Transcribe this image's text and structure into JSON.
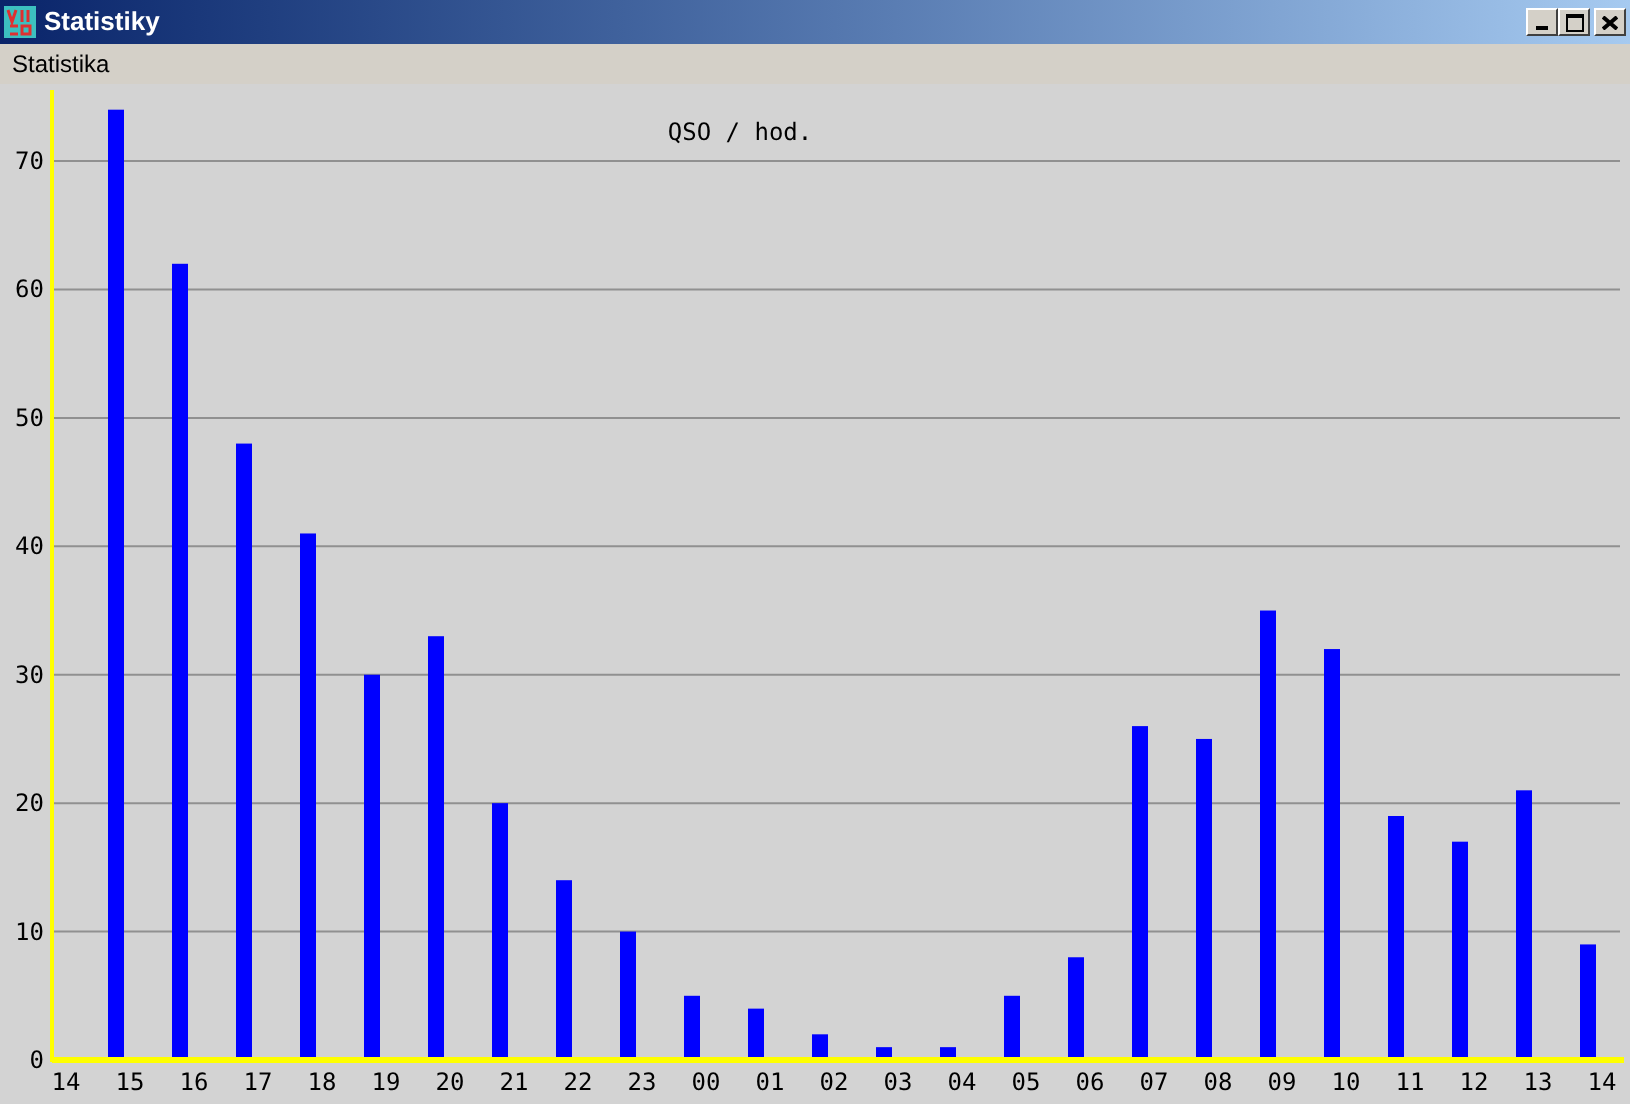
{
  "window": {
    "title": "Statistiky"
  },
  "menu": [
    "Statistika"
  ],
  "chart": {
    "chart_data": {
      "type": "bar",
      "title": "QSO / hod.",
      "categories": [
        "14",
        "15",
        "16",
        "17",
        "18",
        "19",
        "20",
        "21",
        "22",
        "23",
        "00",
        "01",
        "02",
        "03",
        "04",
        "05",
        "06",
        "07",
        "08",
        "09",
        "10",
        "11",
        "12",
        "13",
        "14"
      ],
      "values": [
        0,
        74,
        62,
        48,
        41,
        30,
        33,
        20,
        14,
        10,
        5,
        4,
        2,
        1,
        1,
        5,
        8,
        26,
        25,
        35,
        32,
        19,
        17,
        21,
        9
      ],
      "ylim": [
        0,
        76
      ],
      "grid": true,
      "yticks": [
        0,
        10,
        20,
        30,
        40,
        50,
        60,
        70
      ]
    }
  }
}
